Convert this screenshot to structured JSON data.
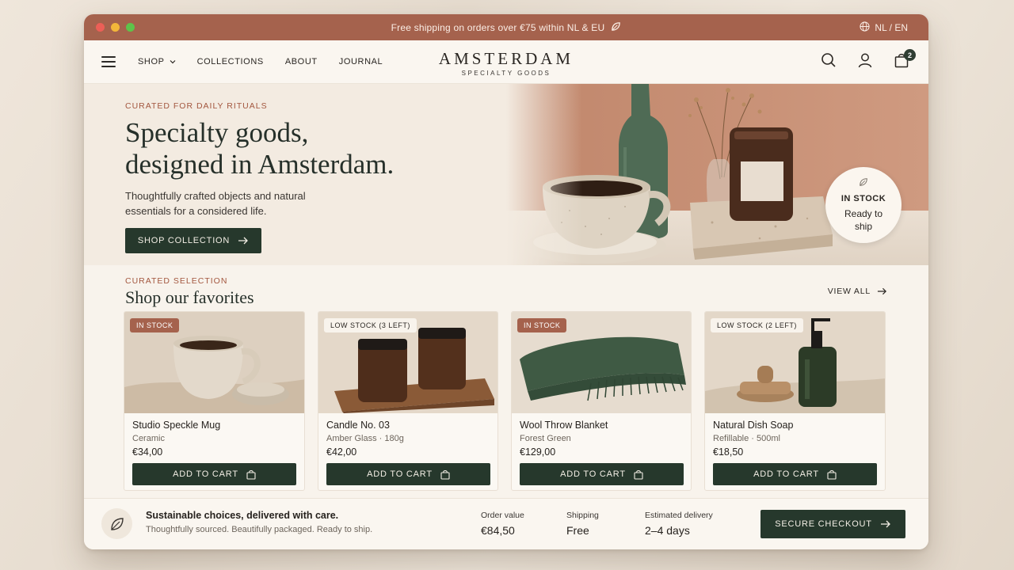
{
  "announcement": {
    "text": "Free shipping on orders over €75 within NL & EU",
    "language": "NL / EN"
  },
  "nav": {
    "links": [
      "SHOP",
      "COLLECTIONS",
      "ABOUT",
      "JOURNAL"
    ],
    "brand": "AMSTERDAM",
    "brand_sub": "SPECIALTY GOODS",
    "cart_count": "2"
  },
  "hero": {
    "eyebrow": "CURATED FOR DAILY RITUALS",
    "title_line1": "Specialty goods,",
    "title_line2": "designed in Amsterdam.",
    "description": "Thoughtfully crafted objects and natural essentials for a considered life.",
    "cta": "SHOP COLLECTION",
    "badge_title": "IN STOCK",
    "badge_text": "Ready to ship"
  },
  "favorites": {
    "eyebrow": "CURATED SELECTION",
    "title": "Shop our favorites",
    "view_all": "VIEW ALL",
    "add_to_cart": "ADD TO CART",
    "products": [
      {
        "tag": "IN STOCK",
        "name": "Studio Speckle Mug",
        "meta": "Ceramic",
        "price": "€34,00"
      },
      {
        "tag": "LOW STOCK (3 LEFT)",
        "name": "Candle No. 03",
        "meta": "Amber Glass · 180g",
        "price": "€42,00"
      },
      {
        "tag": "IN STOCK",
        "name": "Wool Throw Blanket",
        "meta": "Forest Green",
        "price": "€129,00"
      },
      {
        "tag": "LOW STOCK (2 LEFT)",
        "name": "Natural Dish Soap",
        "meta": "Refillable · 500ml",
        "price": "€18,50"
      }
    ]
  },
  "footer_bar": {
    "headline": "Sustainable choices, delivered with care.",
    "subline": "Thoughtfully sourced. Beautifully packaged. Ready to ship.",
    "order_value_label": "Order value",
    "order_value": "€84,50",
    "shipping_label": "Shipping",
    "shipping_value": "Free",
    "delivery_label": "Estimated delivery",
    "delivery_value": "2–4 days",
    "checkout": "SECURE CHECKOUT"
  },
  "colors": {
    "accent_terracotta": "#a5624d",
    "dark_green": "#26382c",
    "background": "#f8f3ec"
  }
}
